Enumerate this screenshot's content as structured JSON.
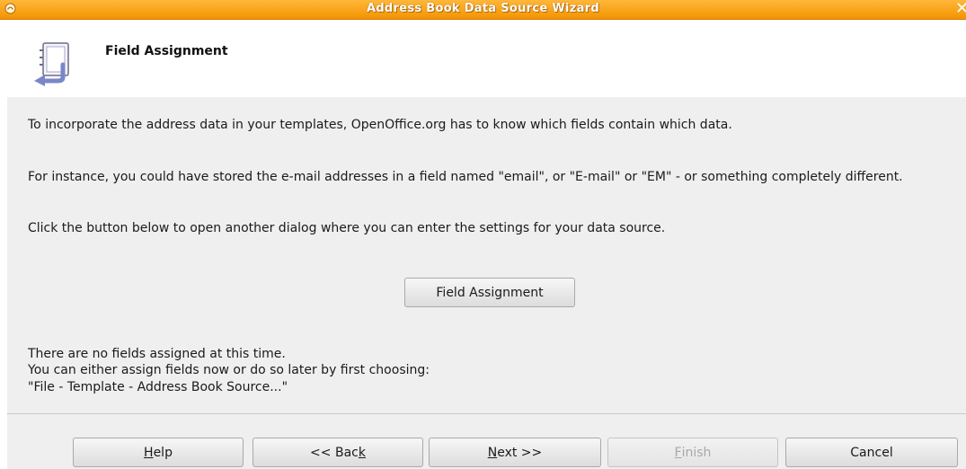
{
  "window": {
    "title": "Address Book Data Source Wizard",
    "menu_icon": "window-menu-icon",
    "close_icon": "close-icon"
  },
  "header": {
    "title": "Field Assignment",
    "icon": "address-book-icon"
  },
  "content": {
    "paragraph1": "To incorporate the address data in your templates, OpenOffice.org has to know which fields contain which data.",
    "paragraph2": "For instance, you could have stored the e-mail addresses in a field named \"email\", or \"E-mail\" or \"EM\" - or something completely different.",
    "paragraph3": "Click the button below to open another dialog where you can enter the settings for your data source.",
    "field_assignment_button": "Field Assignment",
    "status_line1": "There are no fields assigned at this time.",
    "status_line2": "You can either assign fields now or do so later by first choosing:",
    "status_line3": "\"File - Template - Address Book Source...\""
  },
  "buttons": {
    "help": {
      "pre": "",
      "mnemonic": "H",
      "post": "elp"
    },
    "back": {
      "pre": "<< Bac",
      "mnemonic": "k",
      "post": ""
    },
    "next": {
      "pre": "",
      "mnemonic": "N",
      "post": "ext >>"
    },
    "finish": {
      "pre": "",
      "mnemonic": "F",
      "post": "inish",
      "enabled": false
    },
    "cancel": {
      "pre": "Cancel",
      "mnemonic": "",
      "post": ""
    }
  }
}
